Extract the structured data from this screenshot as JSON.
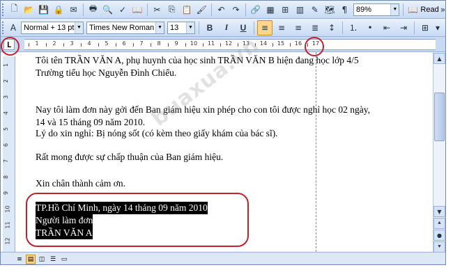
{
  "toolbar1": {
    "zoom": "89%",
    "read_label": "Read",
    "icons": [
      "new-document-icon",
      "open-icon",
      "save-icon",
      "permission-icon",
      "email-icon",
      "print-icon",
      "print-preview-icon",
      "spelling-icon",
      "research-icon",
      "cut-icon",
      "copy-icon",
      "paste-icon",
      "format-painter-icon",
      "undo-icon",
      "redo-icon",
      "hyperlink-icon",
      "tables-borders-icon",
      "insert-table-icon",
      "show-hide-icon"
    ]
  },
  "toolbar2": {
    "style": "Normal + 13 pt",
    "font": "Times New Roman",
    "size": "13",
    "bold": "B",
    "italic": "I",
    "underline": "U"
  },
  "ruler": {
    "numbers": [
      "1",
      "2",
      "3",
      "4",
      "5",
      "6",
      "7",
      "8",
      "9",
      "10",
      "11",
      "12",
      "13",
      "14",
      "15",
      "16",
      "17"
    ],
    "vertical_numbers": [
      "1",
      "2",
      "3",
      "4",
      "5",
      "6",
      "7",
      "8",
      "9",
      "10",
      "11",
      "12"
    ],
    "tab_marker": "L"
  },
  "document": {
    "paragraphs": [
      {
        "text": "Tôi tên TRẦN VĂN A, phụ huynh của học sinh TRẦN VĂN B hiện đang học lớp 4/5",
        "selected": false
      },
      {
        "text": "Trường tiểu học Nguyễn Đình Chiểu.",
        "selected": false
      },
      {
        "text": "Nay tôi làm đơn này gởi đến Ban giám hiệu xin phép cho con tôi được nghỉ học 02 ngày,",
        "selected": false
      },
      {
        "text": "14 và 15 tháng 09 năm 2010.",
        "selected": false
      },
      {
        "text": "Lý do xin nghỉ: Bị nóng sốt (có kèm theo giấy khám của bác sĩ).",
        "selected": false
      },
      {
        "text": "Rất mong được sự chấp thuận của Ban giám hiệu.",
        "selected": false
      },
      {
        "text": "Xin chân thành cảm ơn.",
        "selected": false
      },
      {
        "text": "TP.Hồ Chí Minh, ngày 14 tháng 09  năm 2010",
        "selected": true
      },
      {
        "text": "Người làm đơn",
        "selected": true
      },
      {
        "text": "TRẦN VĂN A",
        "selected": true
      }
    ]
  },
  "watermark": "buaxua.vn",
  "colors": {
    "annotation": "#c2202c",
    "selection": "#000000",
    "toolbar_top": "#e9f1fc",
    "toolbar_bottom": "#c8daf3"
  }
}
